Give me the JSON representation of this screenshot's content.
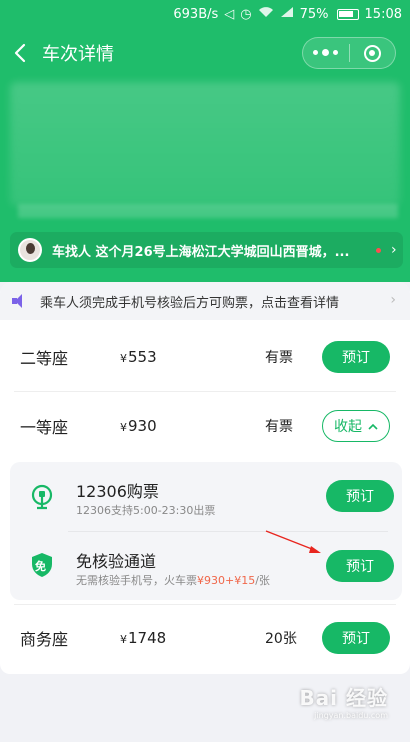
{
  "status_bar": {
    "speed": "693B/s",
    "battery": "75%",
    "time": "15:08"
  },
  "nav": {
    "title": "车次详情"
  },
  "notice": {
    "text": "车找人 这个月26号上海松江大学城回山西晋城，..."
  },
  "warning": {
    "text": "乘车人须完成手机号核验后方可购票，点击查看详情"
  },
  "seats": [
    {
      "name": "二等座",
      "price": "553",
      "availability": "有票",
      "action": "预订"
    },
    {
      "name": "一等座",
      "price": "930",
      "availability": "有票",
      "action": "收起"
    },
    {
      "name": "商务座",
      "price": "1748",
      "availability": "20张",
      "action": "预订"
    }
  ],
  "currency_symbol": "¥",
  "channels": [
    {
      "title": "12306购票",
      "desc": "12306支持5:00-23:30出票",
      "action": "预订"
    },
    {
      "title": "免核验通道",
      "desc_prefix": "无需核验手机号，火车票",
      "desc_highlight": "¥930+¥15",
      "desc_suffix": "/张",
      "badge": "免",
      "action": "预订"
    }
  ],
  "watermark": {
    "text": "Bai 经验",
    "sub": "jingyan.baidu.com"
  },
  "colors": {
    "primary_green": "#17b866",
    "header_green": "#1fbd6b",
    "speaker_purple": "#7b62e8",
    "price_highlight": "#f0674a",
    "annotation_red": "#e8261f"
  }
}
